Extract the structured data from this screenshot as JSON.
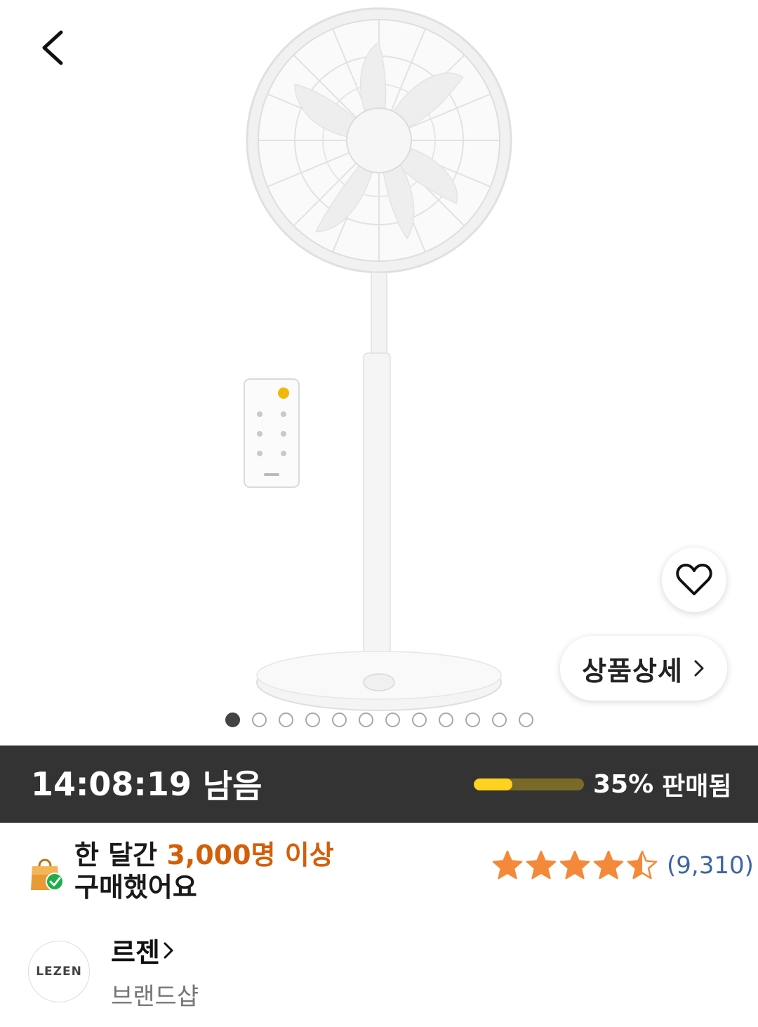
{
  "header": {
    "back_icon": "chevron-left-icon"
  },
  "gallery": {
    "total_images": 12,
    "current_index": 1,
    "wish_icon": "heart-outline-icon",
    "detail_button_label": "상품상세",
    "detail_button_icon": "chevron-right-icon"
  },
  "deal": {
    "time_remaining": "14:08:19",
    "time_suffix": "남음",
    "sold_fraction": 0.35,
    "sold_percent": "35%",
    "sold_label": "판매됨",
    "colors": {
      "bar_bg": "#333333",
      "progress_fill": "#ffd21f",
      "progress_track": "#7a6a28"
    }
  },
  "popularity": {
    "icon": "shopping-bag-check-icon",
    "prefix": "한 달간",
    "highlight": "3,000명 이상",
    "suffix": "구매했어요",
    "accent_color": "#d35f0a"
  },
  "rating": {
    "stars": 4.5,
    "review_count": "(9,310)",
    "star_color": "#f5893a"
  },
  "brand": {
    "logo_text": "LEZEN",
    "name": "르젠",
    "name_icon": "chevron-right-icon",
    "subtitle": "브랜드샵"
  }
}
